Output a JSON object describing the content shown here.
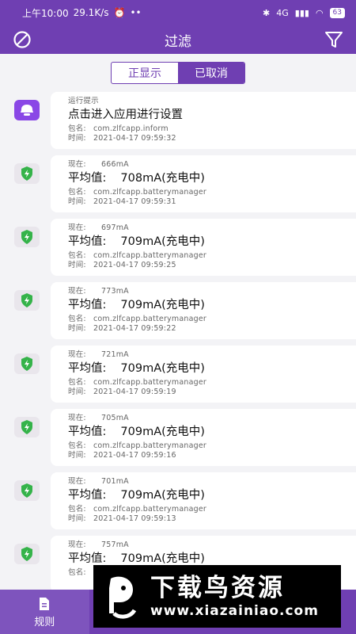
{
  "status_bar": {
    "time": "上午10:00",
    "speed": "29.1K/s",
    "network": "4G",
    "battery": "63"
  },
  "header": {
    "title": "过滤"
  },
  "segment": {
    "options": [
      "正显示",
      "已取消"
    ],
    "selected": "已取消"
  },
  "labels": {
    "now": "现在:",
    "package": "包名:",
    "time": "时间:",
    "avg": "平均值:"
  },
  "entries": [
    {
      "tag": "运行提示",
      "message": "点击进入应用进行设置",
      "package": "com.zlfcapp.inform",
      "time": "2021-04-17 09:59:32",
      "icon": "app-notification-icon"
    },
    {
      "current": "666mA",
      "avg": "708mA(充电中)",
      "package": "com.zlfcapp.batterymanager",
      "time": "2021-04-17 09:59:31",
      "icon": "battery-shield-icon"
    },
    {
      "current": "697mA",
      "avg": "709mA(充电中)",
      "package": "com.zlfcapp.batterymanager",
      "time": "2021-04-17 09:59:25",
      "icon": "battery-shield-icon"
    },
    {
      "current": "773mA",
      "avg": "709mA(充电中)",
      "package": "com.zlfcapp.batterymanager",
      "time": "2021-04-17 09:59:22",
      "icon": "battery-shield-icon"
    },
    {
      "current": "721mA",
      "avg": "709mA(充电中)",
      "package": "com.zlfcapp.batterymanager",
      "time": "2021-04-17 09:59:19",
      "icon": "battery-shield-icon"
    },
    {
      "current": "705mA",
      "avg": "709mA(充电中)",
      "package": "com.zlfcapp.batterymanager",
      "time": "2021-04-17 09:59:16",
      "icon": "battery-shield-icon"
    },
    {
      "current": "701mA",
      "avg": "709mA(充电中)",
      "package": "com.zlfcapp.batterymanager",
      "time": "2021-04-17 09:59:13",
      "icon": "battery-shield-icon"
    },
    {
      "current": "757mA",
      "avg": "709mA(充电中)",
      "package": "",
      "time": "",
      "icon": "battery-shield-icon"
    }
  ],
  "bottom_nav": {
    "items": [
      "规则"
    ],
    "active": "规则"
  },
  "watermark": {
    "text": "下载鸟资源",
    "url": "www.xiazainiao.com"
  },
  "colors": {
    "primary": "#6f3fb2",
    "shield_green": "#35b34a",
    "app_icon": "#8a47e6"
  }
}
